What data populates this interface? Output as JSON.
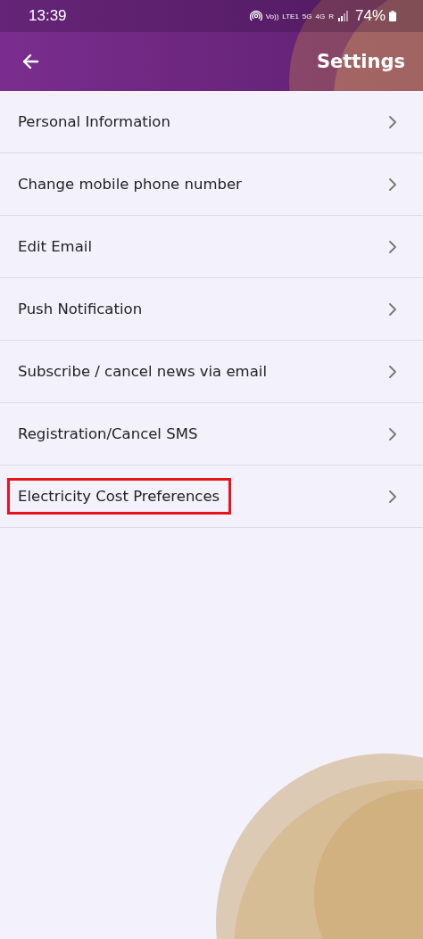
{
  "status_bar": {
    "time": "13:39",
    "network_labels": [
      "Vo))",
      "LTE1",
      "5G",
      "4G",
      "R"
    ],
    "battery": "74%"
  },
  "header": {
    "title": "Settings"
  },
  "items": [
    {
      "label": "Personal Information",
      "highlighted": false
    },
    {
      "label": "Change mobile phone number",
      "highlighted": false
    },
    {
      "label": "Edit Email",
      "highlighted": false
    },
    {
      "label": "Push Notification",
      "highlighted": false
    },
    {
      "label": "Subscribe / cancel news via email",
      "highlighted": false
    },
    {
      "label": "Registration/Cancel SMS",
      "highlighted": false
    },
    {
      "label": "Electricity Cost Preferences",
      "highlighted": true
    }
  ]
}
